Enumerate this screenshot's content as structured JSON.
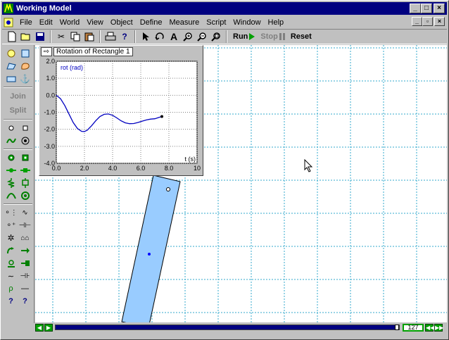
{
  "window": {
    "title": "Working Model",
    "app_icon": "working-model-icon"
  },
  "title_buttons": [
    "_",
    "□",
    "×"
  ],
  "menu": [
    "File",
    "Edit",
    "World",
    "View",
    "Object",
    "Define",
    "Measure",
    "Script",
    "Window",
    "Help"
  ],
  "mdi_buttons": [
    "_",
    "▫",
    "×"
  ],
  "toolbar": {
    "icons": [
      "new-file-icon",
      "open-folder-icon",
      "save-disk-icon",
      "cut-scissors-icon",
      "copy-icon",
      "paste-icon",
      "print-icon",
      "help-pointer-icon",
      "arrow-pointer-icon",
      "rotate-icon",
      "text-A-icon",
      "zoom-in-icon",
      "zoom-out-icon",
      "zoom-fit-icon"
    ],
    "run_label": "Run",
    "stop_label": "Stop",
    "reset_label": "Reset"
  },
  "palette": {
    "join_label": "Join",
    "split_label": "Split",
    "tools": [
      "circle-tool-icon",
      "square-tool-icon",
      "polygon-tool-icon",
      "curved-body-icon",
      "rectangle-tool-icon",
      "anchor-icon",
      "point-tool-icon",
      "square-point-icon",
      "pin-joint-icon",
      "slot-joint-icon",
      "curved-slot-icon",
      "keyed-slot-icon",
      "rigid-joint-icon",
      "keyed-rigid-icon",
      "spring-icon",
      "damper-icon",
      "gear-icon",
      "torsion-spring-icon",
      "rope-icon",
      "pulley-icon",
      "motor-icon",
      "actuator-icon",
      "force-icon",
      "torque-icon",
      "separator-icon",
      "rod-icon",
      "rotational-spring-icon",
      "rotational-damper-icon",
      "help-tool-icon",
      "help-tool-2-icon"
    ]
  },
  "meter": {
    "title": "Rotation of Rectangle 1",
    "series_label": "rot (rad)",
    "x_axis_label": "t (s)"
  },
  "chart_data": {
    "type": "line",
    "title": "Rotation of Rectangle 1",
    "xlabel": "t (s)",
    "ylabel": "rot (rad)",
    "xlim": [
      0,
      10
    ],
    "ylim": [
      -4.0,
      2.0
    ],
    "x_ticks": [
      "0.0",
      "2.0",
      "4.0",
      "6.0",
      "8.0",
      "10"
    ],
    "y_ticks": [
      "2.0",
      "1.0",
      "0.0",
      "-1.0",
      "-2.0",
      "-3.0",
      "-4.0"
    ],
    "grid": true,
    "series": [
      {
        "name": "rot (rad)",
        "color": "#0000c0",
        "x": [
          0.0,
          0.3,
          0.6,
          0.9,
          1.2,
          1.5,
          1.8,
          2.0,
          2.2,
          2.5,
          2.8,
          3.1,
          3.4,
          3.7,
          4.0,
          4.3,
          4.6,
          4.9,
          5.2,
          5.5,
          5.8,
          6.1,
          6.4,
          6.7,
          7.0,
          7.3,
          7.5
        ],
        "values": [
          0.0,
          -0.2,
          -0.6,
          -1.1,
          -1.6,
          -1.95,
          -2.12,
          -2.13,
          -2.05,
          -1.8,
          -1.5,
          -1.25,
          -1.12,
          -1.1,
          -1.18,
          -1.33,
          -1.5,
          -1.62,
          -1.67,
          -1.66,
          -1.6,
          -1.52,
          -1.45,
          -1.4,
          -1.38,
          -1.3,
          -1.25
        ]
      }
    ]
  },
  "frame_counter": "127",
  "colors": {
    "title_bar": "#000080",
    "body_fill": "#99ccff",
    "grid": "#33aacc",
    "run_green": "#00a000"
  }
}
